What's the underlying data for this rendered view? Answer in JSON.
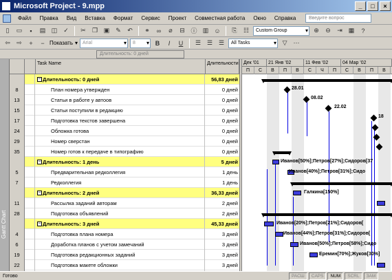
{
  "window": {
    "title": "Microsoft Project - 9.mpp"
  },
  "menu": {
    "items": [
      "Файл",
      "Правка",
      "Вид",
      "Вставка",
      "Формат",
      "Сервис",
      "Проект",
      "Совместная работа",
      "Окно",
      "Справка"
    ],
    "help_placeholder": "Введите вопрос"
  },
  "toolbar": {
    "group_combo": "Custom Group",
    "show_label": "Показать",
    "font_combo": "Arial",
    "size_combo": "8",
    "filter_combo": "All Tasks"
  },
  "entry_bar": {
    "value": "Длительность: 0 дней"
  },
  "viewbar": {
    "label": "Gantt Chart"
  },
  "grid": {
    "headers": {
      "task_name": "Task Name",
      "duration": "Длительности"
    },
    "rows": [
      {
        "id": "",
        "name": "Длительность: 0 дней",
        "duration": "56,83 дней",
        "summary": true
      },
      {
        "id": "8",
        "name": "План номера утвержден",
        "duration": "0 дней",
        "summary": false
      },
      {
        "id": "13",
        "name": "Статьи в работе у автоов",
        "duration": "0 дней",
        "summary": false
      },
      {
        "id": "15",
        "name": "Статьи поступили в редакцию",
        "duration": "0 дней",
        "summary": false
      },
      {
        "id": "17",
        "name": "Подготовка текстов завершена",
        "duration": "0 дней",
        "summary": false
      },
      {
        "id": "24",
        "name": "Обложка готова",
        "duration": "0 дней",
        "summary": false
      },
      {
        "id": "29",
        "name": "Номер сверстан",
        "duration": "0 дней",
        "summary": false
      },
      {
        "id": "35",
        "name": "Номер готов к передаче в типографию",
        "duration": "0 дней",
        "summary": false
      },
      {
        "id": "",
        "name": "Длительность: 1 день",
        "duration": "5 дней",
        "summary": true
      },
      {
        "id": "5",
        "name": "Предварительная редколлегия",
        "duration": "1 день",
        "summary": false
      },
      {
        "id": "7",
        "name": "Редколлегия",
        "duration": "1 день",
        "summary": false
      },
      {
        "id": "",
        "name": "Длительность: 2 дней",
        "duration": "36,33 дней",
        "summary": true
      },
      {
        "id": "11",
        "name": "Рассылка заданий авторам",
        "duration": "2 дней",
        "summary": false
      },
      {
        "id": "28",
        "name": "Подготовка объявлений",
        "duration": "2 дней",
        "summary": false
      },
      {
        "id": "",
        "name": "Длительность: 3 дней",
        "duration": "45,33 дней",
        "summary": true
      },
      {
        "id": "4",
        "name": "Подготовка плана номера",
        "duration": "3 дней",
        "summary": false
      },
      {
        "id": "6",
        "name": "Доработка планов с учетом замечаний",
        "duration": "3 дней",
        "summary": false
      },
      {
        "id": "19",
        "name": "Подготовка редакционных заданий",
        "duration": "3 дней",
        "summary": false
      },
      {
        "id": "22",
        "name": "Подготовка макете обложки",
        "duration": "3 дней",
        "summary": false
      },
      {
        "id": "23",
        "name": "Подготовка анонсов материлов номера для обложки",
        "duration": "3 дней",
        "summary": false
      }
    ]
  },
  "timeline": {
    "weeks": [
      "Дек '01",
      "21 Янв '02",
      "11 Фев '02",
      "04 Мар '02"
    ],
    "days": [
      "П",
      "С",
      "В",
      "П",
      "В",
      "С",
      "Ч",
      "П",
      "С",
      "В",
      "П",
      "В"
    ]
  },
  "gantt": {
    "milestone_labels": [
      "28.01",
      "08.02",
      "22.02",
      "18"
    ],
    "resource_labels": [
      "Иванов[50%];Петров[27%];Сидоров[37",
      "Иванов[40%];Петров[31%];Сидо",
      "Галкина[150%]",
      "Иванов[20%];Петров[21%];Сидоров[",
      "Иванов[44%];Петров[31%];Сидоров[",
      "Иванов[50%];Петров[58%];Сидо",
      "Еремин[70%];Жуков[30%]"
    ]
  },
  "status": {
    "ready": "Готово",
    "indicators": [
      "РАСШ",
      "CAPS",
      "NUM",
      "SCRL",
      "ЗАМ"
    ],
    "active": [
      "NUM"
    ]
  }
}
